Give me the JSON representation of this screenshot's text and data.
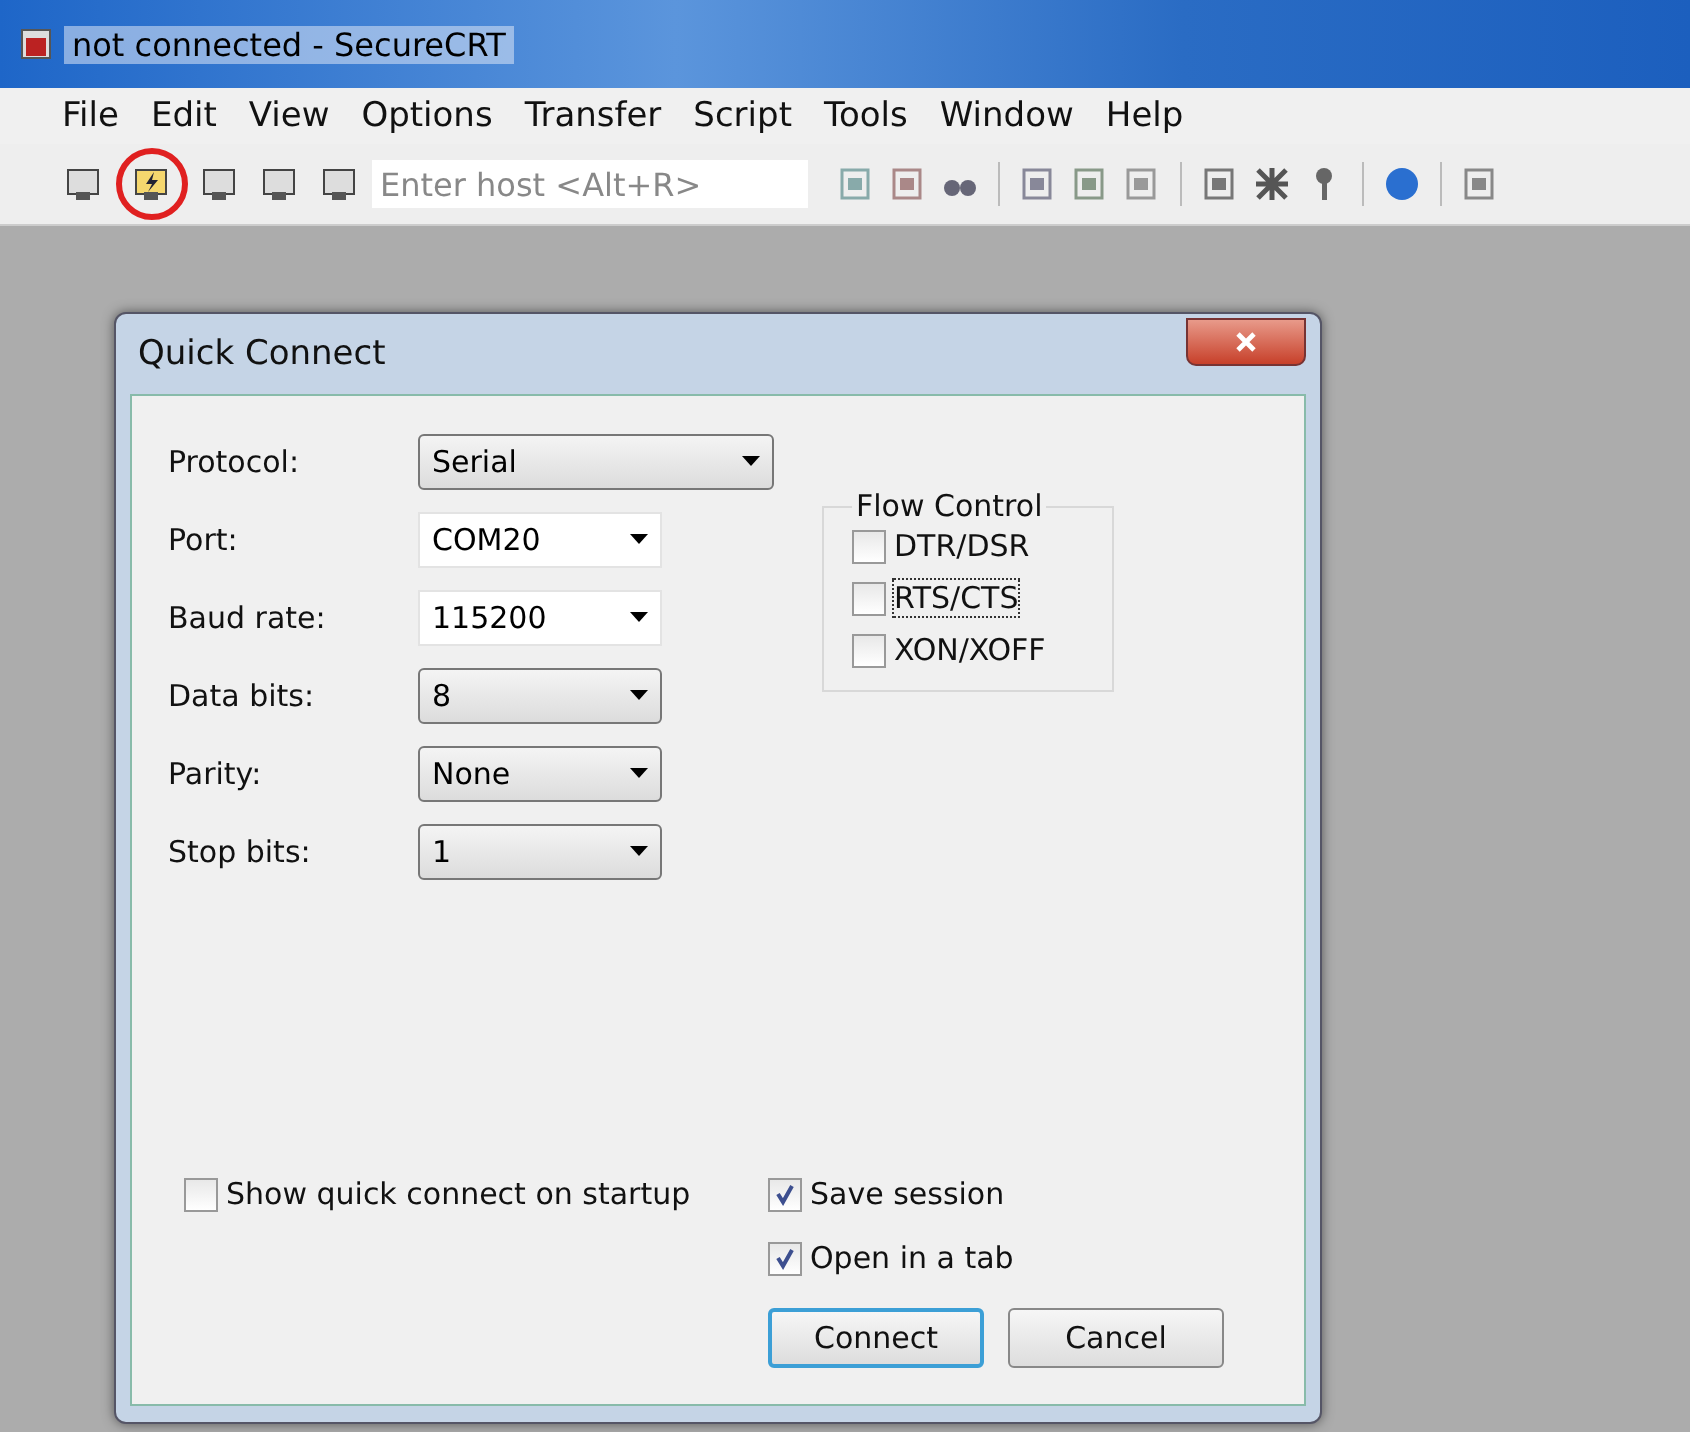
{
  "window": {
    "title": "not connected - SecureCRT"
  },
  "menu": [
    "File",
    "Edit",
    "View",
    "Options",
    "Transfer",
    "Script",
    "Tools",
    "Window",
    "Help"
  ],
  "toolbar": {
    "buttons": [
      {
        "highlighted": false
      },
      {
        "highlighted": true
      },
      {
        "highlighted": false
      },
      {
        "highlighted": false
      },
      {
        "highlighted": false
      }
    ],
    "host_field": {
      "placeholder": "Enter host <Alt+R>"
    }
  },
  "dialog": {
    "title": "Quick Connect",
    "fields": [
      {
        "label": "Protocol:",
        "value": "Serial",
        "kind": "dropdown",
        "wide": true
      },
      {
        "label": "Port:",
        "value": "COM20",
        "kind": "editable",
        "wide": false
      },
      {
        "label": "Baud rate:",
        "value": "115200",
        "kind": "editable",
        "wide": false
      },
      {
        "label": "Data bits:",
        "value": "8",
        "kind": "dropdown",
        "wide": false
      },
      {
        "label": "Parity:",
        "value": "None",
        "kind": "dropdown",
        "wide": false
      },
      {
        "label": "Stop bits:",
        "value": "1",
        "kind": "dropdown",
        "wide": false
      }
    ],
    "flow_control": {
      "title": "Flow Control",
      "options": [
        {
          "label": "DTR/DSR",
          "checked": false,
          "focused": false
        },
        {
          "label": "RTS/CTS",
          "checked": false,
          "focused": true
        },
        {
          "label": "XON/XOFF",
          "checked": false,
          "focused": false
        }
      ]
    },
    "show_on_startup": {
      "label": "Show quick connect on startup",
      "checked": false
    },
    "options": [
      {
        "label": "Save session",
        "checked": true
      },
      {
        "label": "Open in a tab",
        "checked": true
      }
    ],
    "buttons": [
      {
        "label": "Connect",
        "default": true
      },
      {
        "label": "Cancel",
        "default": false
      }
    ]
  }
}
